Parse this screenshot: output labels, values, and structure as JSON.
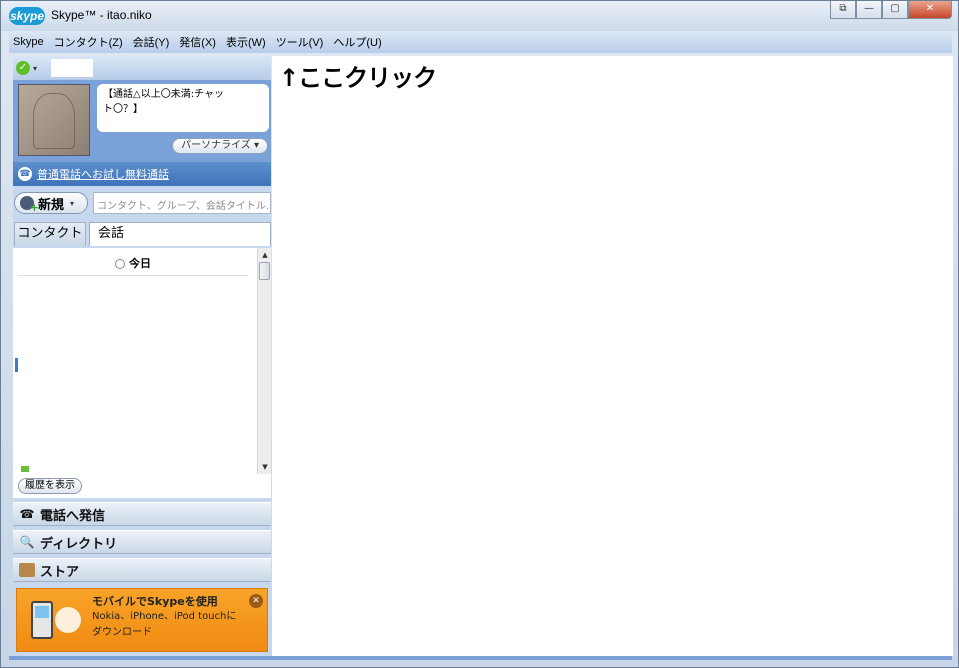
{
  "window": {
    "logo_text": "skype",
    "title": "Skype™ - itao.niko",
    "controls": {
      "restore": "⧉",
      "minimize": "—",
      "maximize": "▢",
      "close": "✕"
    }
  },
  "menu": {
    "items": [
      "Skype",
      "コンタクト(Z)",
      "会話(Y)",
      "発信(X)",
      "表示(W)",
      "ツール(V)",
      "ヘルプ(U)"
    ]
  },
  "profile": {
    "status_icon": "✓",
    "status_caret": "▾",
    "mood_line1": "【通話△以上〇未満:チャッ",
    "mood_line2": "ト〇？】",
    "personalize": "パーソナライズ ▾"
  },
  "call_bar": {
    "icon": "☎",
    "link": "普通電話へお試し無料通話"
  },
  "search": {
    "new_button": "新規",
    "new_caret": "▾",
    "placeholder": "コンタクト、グループ、会話タイトル..."
  },
  "tabs": {
    "contacts": "コンタクト",
    "conversations": "会話"
  },
  "list": {
    "today_label": "今日",
    "scroll_up": "▲",
    "scroll_down": "▼"
  },
  "history_button": "履歴を表示",
  "sections": {
    "call": {
      "icon": "☎",
      "label": "電話へ発信"
    },
    "directory": {
      "icon": "🔍",
      "label": "ディレクトリ"
    },
    "store": {
      "label": "ストア"
    }
  },
  "ad": {
    "title": "モバイルでSkypeを使用",
    "line1": "Nokia、iPhone、iPod touchに",
    "line2": "ダウンロード",
    "close": "✕"
  },
  "main": {
    "annotation": "↑ここクリック"
  }
}
